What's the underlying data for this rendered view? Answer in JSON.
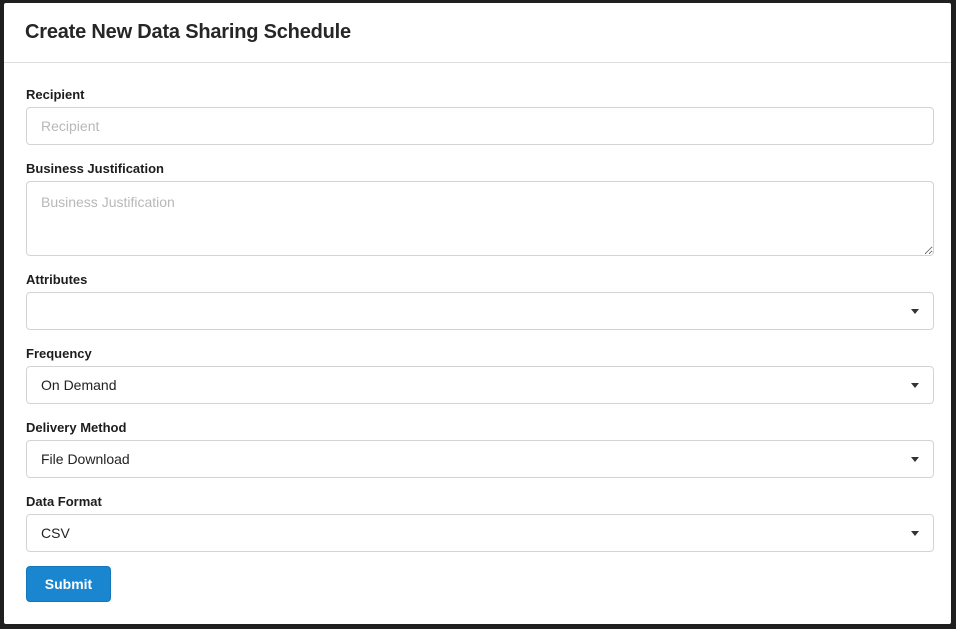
{
  "modal": {
    "title": "Create New Data Sharing Schedule"
  },
  "form": {
    "recipient": {
      "label": "Recipient",
      "placeholder": "Recipient",
      "value": ""
    },
    "business_justification": {
      "label": "Business Justification",
      "placeholder": "Business Justification",
      "value": ""
    },
    "attributes": {
      "label": "Attributes",
      "selected": ""
    },
    "frequency": {
      "label": "Frequency",
      "selected": "On Demand"
    },
    "delivery_method": {
      "label": "Delivery Method",
      "selected": "File Download"
    },
    "data_format": {
      "label": "Data Format",
      "selected": "CSV"
    },
    "submit_label": "Submit"
  },
  "icons": {
    "dropdown": "chevron-down-icon"
  },
  "colors": {
    "primary_button": "#1b86d0",
    "border": "#d3d3d3",
    "placeholder": "#b8b8b8"
  }
}
